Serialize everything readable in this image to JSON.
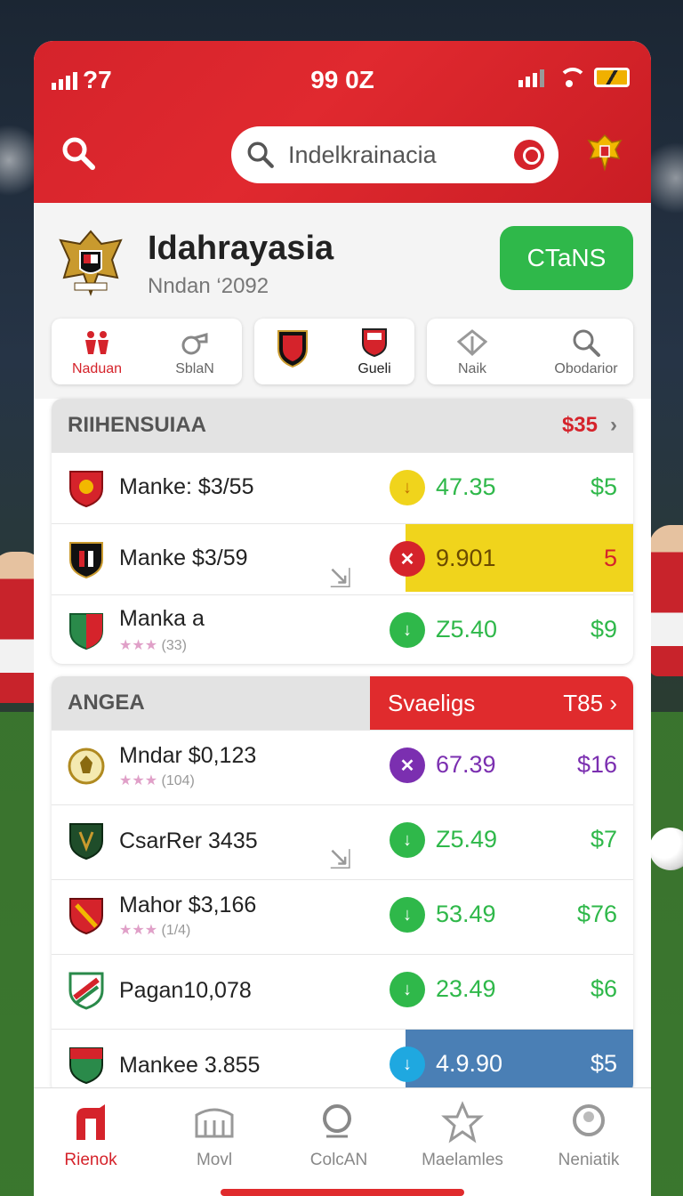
{
  "status": {
    "signal": "?7",
    "time": "99 0Z"
  },
  "search": {
    "placeholder": "Indelkrainacia"
  },
  "profile": {
    "name": "Idahrayasia",
    "subtitle": "Nndan ‘2092",
    "button": "CTaNS"
  },
  "categories": [
    {
      "label": "Naduan",
      "icon": "people-icon",
      "active": true
    },
    {
      "label": "SblaN",
      "icon": "whistle-icon",
      "active": false
    },
    {
      "label": "",
      "icon": "club-crest-icon",
      "active": false
    },
    {
      "label": "Gueli",
      "icon": "flag-crest-icon",
      "active": false
    },
    {
      "label": "Naik",
      "icon": "tent-icon",
      "active": false
    },
    {
      "label": "Obodarior",
      "icon": "search-icon",
      "active": false
    }
  ],
  "section1": {
    "title": "RIIHENSUIAA",
    "right": "$35",
    "rows": [
      {
        "title": "Manke: $3/55",
        "value": "47.35",
        "price": "$5",
        "badge": "down"
      },
      {
        "title": "Manke $3/59",
        "value": "9.901",
        "price": "5",
        "badge": "x"
      },
      {
        "title": "Manka a",
        "stars": "★★★",
        "rating": "(33)",
        "value": "Z5.40",
        "price": "$9",
        "badge": "down"
      }
    ]
  },
  "section2": {
    "title": "ANGEA",
    "promo_left": "Svaeligs",
    "promo_right": "T85",
    "rows": [
      {
        "title": "Mndar $0,123",
        "stars": "★★★",
        "rating": "(104)",
        "value": "67.39",
        "price": "$16",
        "badge": "x"
      },
      {
        "title": "CsarRer 3435",
        "value": "Z5.49",
        "price": "$7",
        "badge": "down"
      },
      {
        "title": "Mahor $3,166",
        "stars": "★★★",
        "rating": "(1/4)",
        "value": "53.49",
        "price": "$76",
        "badge": "down"
      },
      {
        "title": "Pagan10,078",
        "value": "23.49",
        "price": "$6",
        "badge": "down"
      },
      {
        "title": "Mankee 3.855",
        "value": "4.9.90",
        "price": "$5",
        "badge": "down"
      }
    ]
  },
  "tabs": [
    {
      "label": "Rienok",
      "icon": "home-icon",
      "active": true
    },
    {
      "label": "Movl",
      "icon": "stadium-icon",
      "active": false
    },
    {
      "label": "ColcAN",
      "icon": "search-icon",
      "active": false
    },
    {
      "label": "Maelamles",
      "icon": "star-icon",
      "active": false
    },
    {
      "label": "Neniatik",
      "icon": "profile-icon",
      "active": false
    }
  ],
  "colors": {
    "brand": "#d5232b",
    "green": "#2fb84a",
    "yellow": "#f0d41c",
    "purple": "#7b2fb0",
    "blue": "#4a7fb5"
  }
}
